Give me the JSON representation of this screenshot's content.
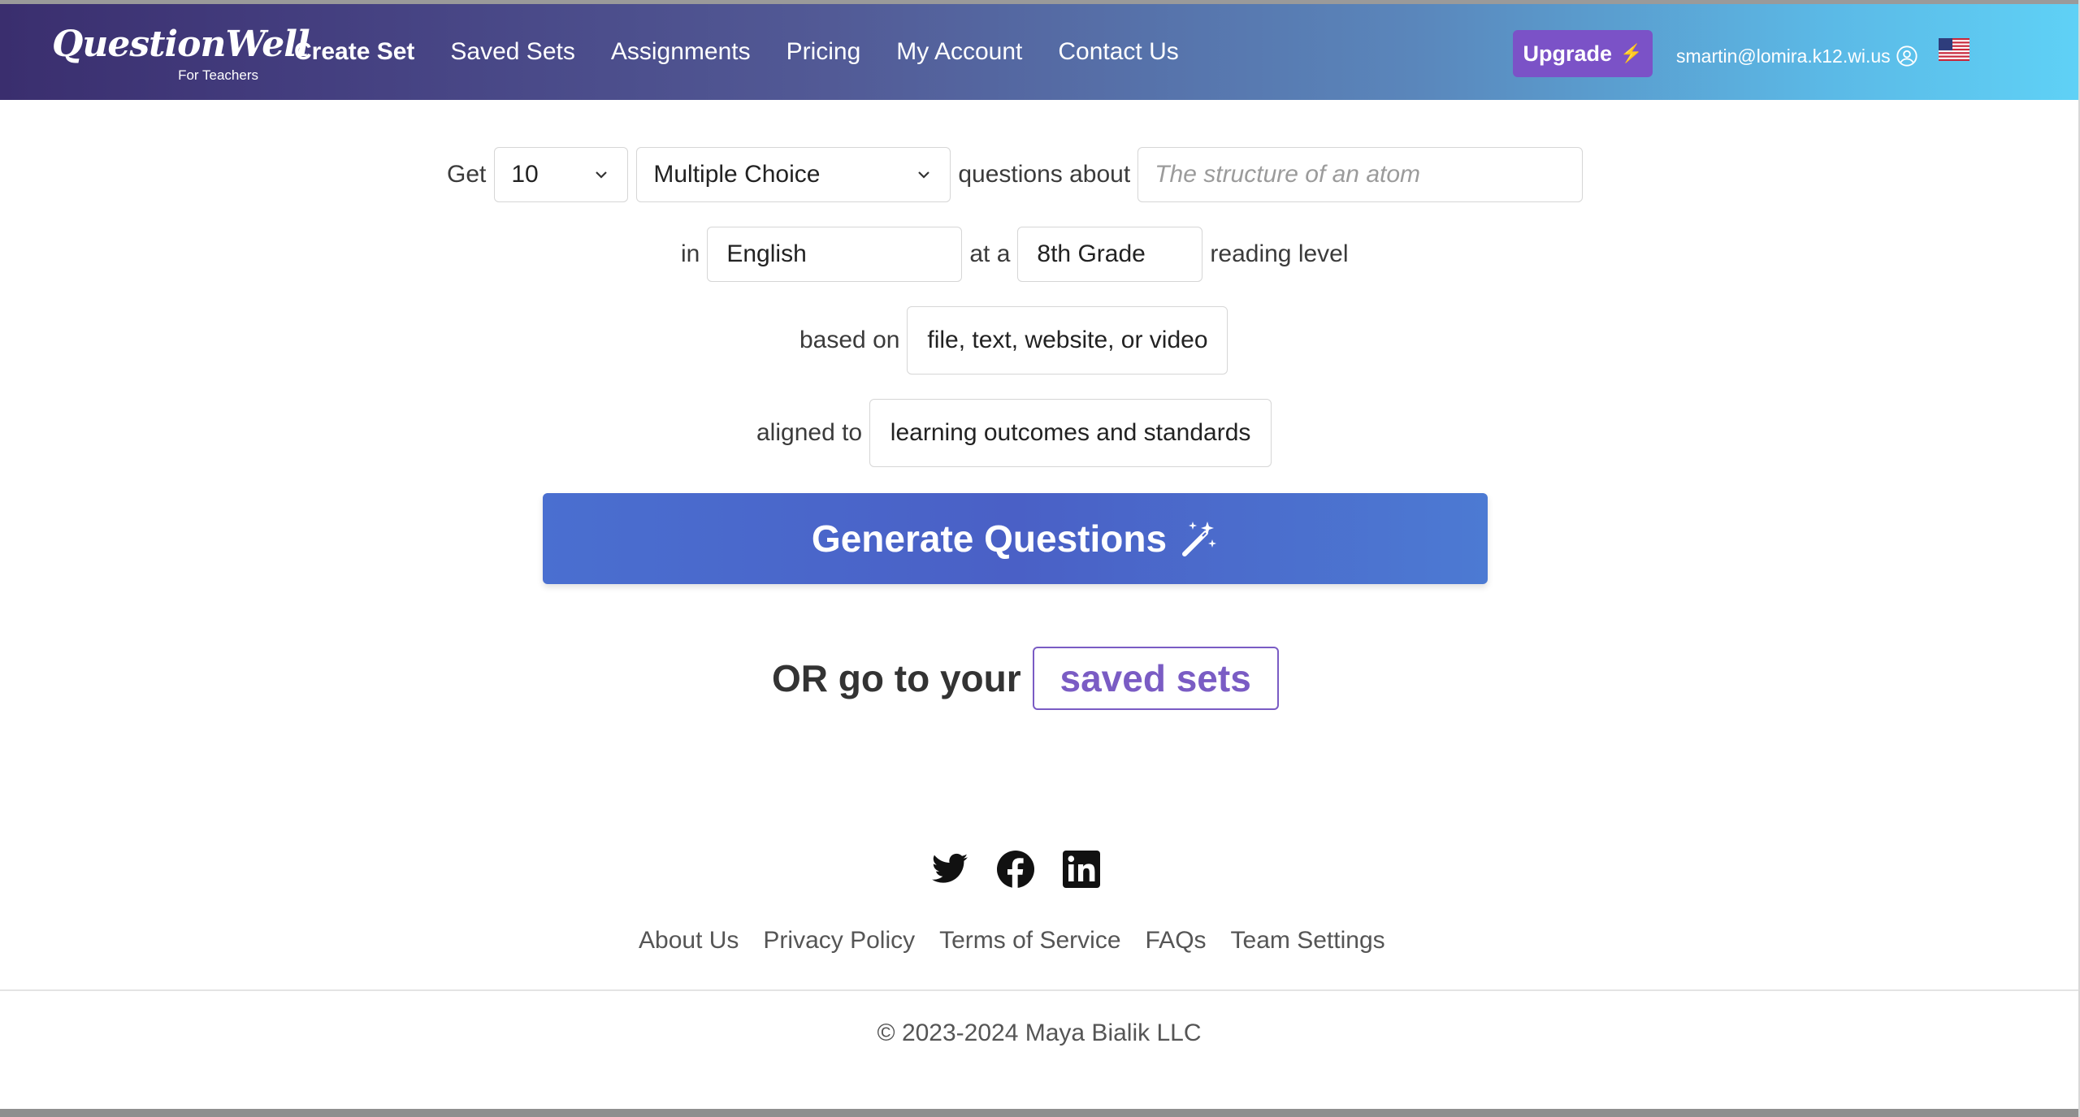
{
  "nav": {
    "logo_text": "QuestionWell",
    "logo_sub": "For Teachers",
    "links": [
      "Create Set",
      "Saved Sets",
      "Assignments",
      "Pricing",
      "My Account",
      "Contact Us"
    ],
    "upgrade_label": "Upgrade",
    "user_email": "smartin@lomira.k12.wi.us"
  },
  "form": {
    "get_label": "Get",
    "count_value": "10",
    "type_value": "Multiple Choice",
    "questions_about_label": "questions about",
    "topic_placeholder": "The structure of an atom",
    "in_label": "in",
    "language_value": "English",
    "at_a_label": "at a",
    "grade_value": "8th Grade",
    "reading_level_label": "reading level",
    "based_on_label": "based on",
    "source_button": "file, text, website, or video",
    "aligned_to_label": "aligned to",
    "standards_button": "learning outcomes and standards",
    "generate_button": "Generate Questions"
  },
  "saved": {
    "or_text": "OR go to your",
    "saved_sets_button": "saved sets"
  },
  "footer": {
    "links": [
      "About Us",
      "Privacy Policy",
      "Terms of Service",
      "FAQs",
      "Team Settings"
    ],
    "copyright": "© 2023-2024 Maya Bialik LLC"
  },
  "icons": {
    "social": [
      "twitter-icon",
      "facebook-icon",
      "linkedin-icon"
    ],
    "navbar": [
      "lightning-icon",
      "user-circle-icon",
      "us-flag-icon"
    ],
    "button": [
      "magic-wand-icon"
    ]
  },
  "colors": {
    "nav_gradient_start": "#3a2e6e",
    "nav_gradient_end": "#5fd1f6",
    "upgrade_bg": "#7b52c7",
    "primary_button": "#4a65c9",
    "saved_sets_accent": "#7a5cc4"
  }
}
